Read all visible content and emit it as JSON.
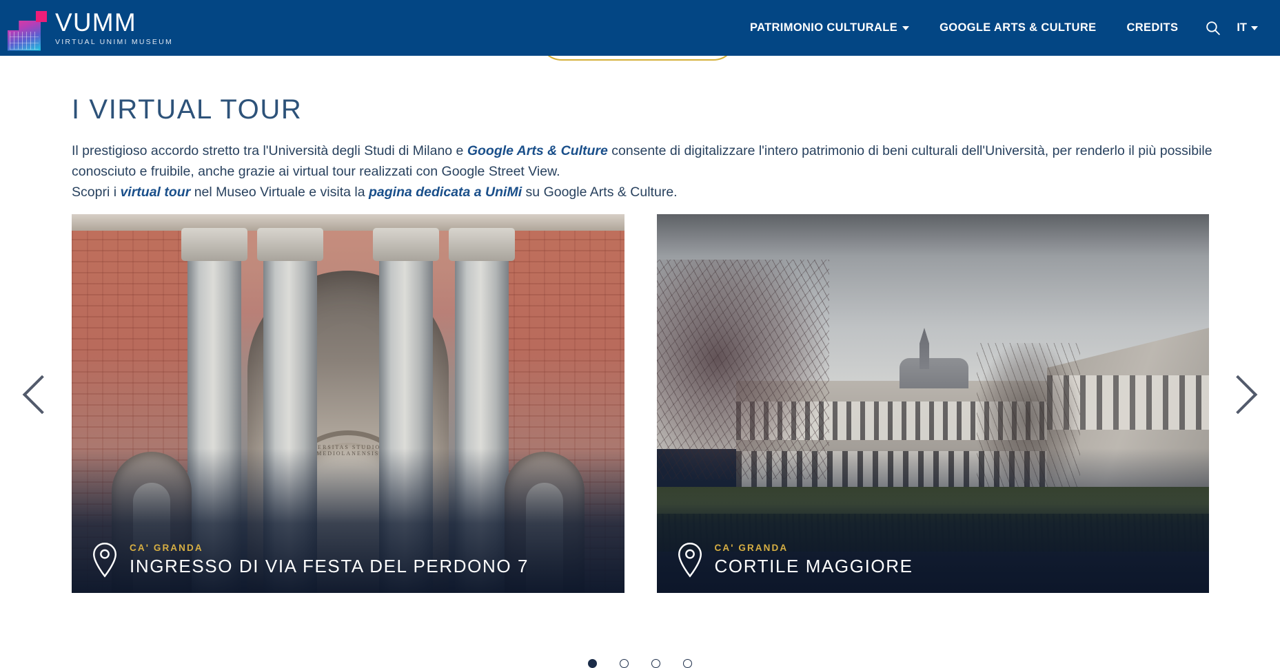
{
  "brand": {
    "title": "VUMM",
    "subtitle": "VIRTUAL UNIMI MUSEUM",
    "logo_icon": "vumm-building-logo-icon"
  },
  "nav": {
    "items": [
      {
        "label": "PATRIMONIO CULTURALE",
        "has_dropdown": true
      },
      {
        "label": "GOOGLE ARTS & CULTURE",
        "has_dropdown": false
      },
      {
        "label": "CREDITS",
        "has_dropdown": false
      }
    ],
    "search_icon": "search-icon",
    "language": "IT",
    "background_color": "#034684"
  },
  "hero_button": {
    "border_color": "#d4af37"
  },
  "main": {
    "title": "I VIRTUAL TOUR",
    "paragraph": {
      "line1_a": "Il prestigioso accordo stretto tra l'Università degli Studi di Milano e ",
      "link1": "Google Arts & Culture",
      "line1_b": " consente di digitalizzare l'intero patrimonio di beni culturali dell'Università, per renderlo il più possibile conosciuto e fruibile, anche grazie ai virtual tour realizzati con Google Street View.",
      "line2_a": "Scopri i ",
      "link2": "virtual tour",
      "line2_b": " nel Museo Virtuale e visita la ",
      "link3": "pagina dedicata a UniMi",
      "line2_c": " su Google Arts & Culture."
    },
    "title_color": "#2d5279",
    "text_color": "#28415e",
    "link_color": "#1a4f8a"
  },
  "carousel": {
    "prev_icon": "chevron-left-icon",
    "next_icon": "chevron-right-icon",
    "cards": [
      {
        "place": "CA' GRANDA",
        "name": "INGRESSO DI VIA FESTA DEL PERDONO 7",
        "pin_icon": "map-pin-icon",
        "artwork": "neoclassical-entrance-photo",
        "inscription": "UNIVERSITAS STUDIORUM MEDIOLANENSIS"
      },
      {
        "place": "CA' GRANDA",
        "name": "CORTILE MAGGIORE",
        "pin_icon": "map-pin-icon",
        "artwork": "misty-courtyard-photo",
        "inscription": ""
      }
    ],
    "pagination": {
      "total": 4,
      "active_index": 0
    },
    "place_color": "#d7af43"
  }
}
